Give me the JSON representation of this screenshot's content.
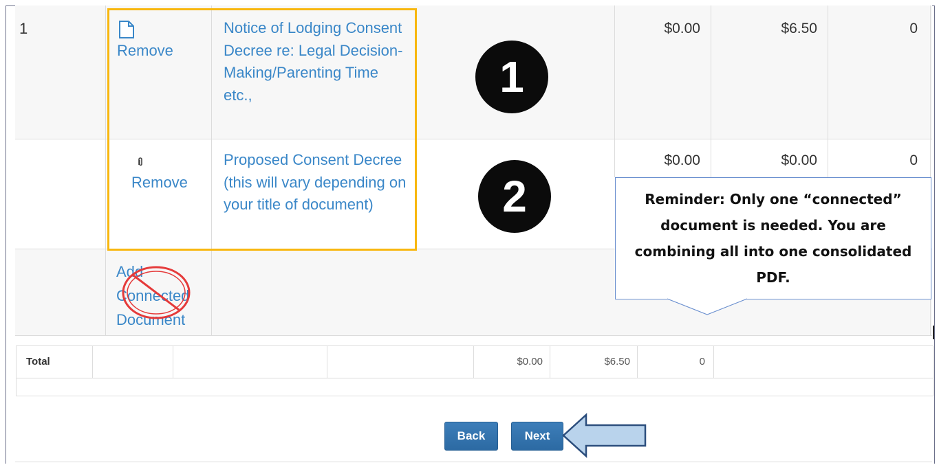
{
  "rows": [
    {
      "number": "1",
      "action_label": "Remove",
      "document_title": "Notice of Lodging Consent Decree re: Legal Decision-Making/Parenting Time etc.,",
      "col_a": "$0.00",
      "col_b": "$6.50",
      "col_c": "0"
    },
    {
      "number": "",
      "action_label": "Remove",
      "document_title": "Proposed Consent Decree (this will vary depending on your title of document)",
      "col_a": "$0.00",
      "col_b": "$0.00",
      "col_c": "0"
    }
  ],
  "add_connected_label": "Add Connected Document",
  "annotations": {
    "step_1": "1",
    "step_2": "2",
    "callout_text": "Reminder: Only one “connected” document is needed. You are combining all into one consolidated PDF."
  },
  "totals": {
    "label": "Total",
    "col_a": "$0.00",
    "col_b": "$6.50",
    "col_c": "0"
  },
  "buttons": {
    "back_label": "Back",
    "next_label": "Next"
  },
  "icons": {
    "document": "document-icon",
    "attachment": "paperclip-icon",
    "prohibited": "no-sign-icon",
    "arrow": "left-arrow-icon"
  },
  "colors": {
    "highlight": "#f8b70f",
    "link": "#3a87c8",
    "button": "#2c6aa3",
    "callout_border": "#6a8fcf",
    "arrow_fill": "#b9d3ec"
  }
}
